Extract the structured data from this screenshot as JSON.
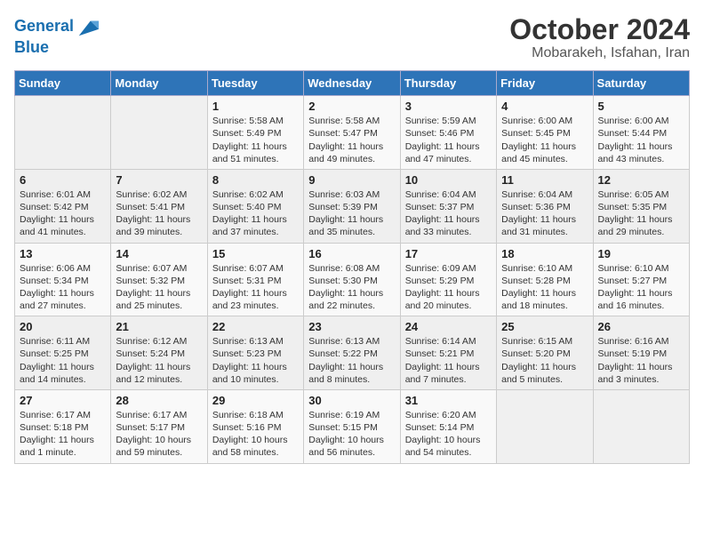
{
  "header": {
    "logo_line1": "General",
    "logo_line2": "Blue",
    "title": "October 2024",
    "subtitle": "Mobarakeh, Isfahan, Iran"
  },
  "weekdays": [
    "Sunday",
    "Monday",
    "Tuesday",
    "Wednesday",
    "Thursday",
    "Friday",
    "Saturday"
  ],
  "weeks": [
    [
      {
        "day": "",
        "info": ""
      },
      {
        "day": "",
        "info": ""
      },
      {
        "day": "1",
        "info": "Sunrise: 5:58 AM\nSunset: 5:49 PM\nDaylight: 11 hours and 51 minutes."
      },
      {
        "day": "2",
        "info": "Sunrise: 5:58 AM\nSunset: 5:47 PM\nDaylight: 11 hours and 49 minutes."
      },
      {
        "day": "3",
        "info": "Sunrise: 5:59 AM\nSunset: 5:46 PM\nDaylight: 11 hours and 47 minutes."
      },
      {
        "day": "4",
        "info": "Sunrise: 6:00 AM\nSunset: 5:45 PM\nDaylight: 11 hours and 45 minutes."
      },
      {
        "day": "5",
        "info": "Sunrise: 6:00 AM\nSunset: 5:44 PM\nDaylight: 11 hours and 43 minutes."
      }
    ],
    [
      {
        "day": "6",
        "info": "Sunrise: 6:01 AM\nSunset: 5:42 PM\nDaylight: 11 hours and 41 minutes."
      },
      {
        "day": "7",
        "info": "Sunrise: 6:02 AM\nSunset: 5:41 PM\nDaylight: 11 hours and 39 minutes."
      },
      {
        "day": "8",
        "info": "Sunrise: 6:02 AM\nSunset: 5:40 PM\nDaylight: 11 hours and 37 minutes."
      },
      {
        "day": "9",
        "info": "Sunrise: 6:03 AM\nSunset: 5:39 PM\nDaylight: 11 hours and 35 minutes."
      },
      {
        "day": "10",
        "info": "Sunrise: 6:04 AM\nSunset: 5:37 PM\nDaylight: 11 hours and 33 minutes."
      },
      {
        "day": "11",
        "info": "Sunrise: 6:04 AM\nSunset: 5:36 PM\nDaylight: 11 hours and 31 minutes."
      },
      {
        "day": "12",
        "info": "Sunrise: 6:05 AM\nSunset: 5:35 PM\nDaylight: 11 hours and 29 minutes."
      }
    ],
    [
      {
        "day": "13",
        "info": "Sunrise: 6:06 AM\nSunset: 5:34 PM\nDaylight: 11 hours and 27 minutes."
      },
      {
        "day": "14",
        "info": "Sunrise: 6:07 AM\nSunset: 5:32 PM\nDaylight: 11 hours and 25 minutes."
      },
      {
        "day": "15",
        "info": "Sunrise: 6:07 AM\nSunset: 5:31 PM\nDaylight: 11 hours and 23 minutes."
      },
      {
        "day": "16",
        "info": "Sunrise: 6:08 AM\nSunset: 5:30 PM\nDaylight: 11 hours and 22 minutes."
      },
      {
        "day": "17",
        "info": "Sunrise: 6:09 AM\nSunset: 5:29 PM\nDaylight: 11 hours and 20 minutes."
      },
      {
        "day": "18",
        "info": "Sunrise: 6:10 AM\nSunset: 5:28 PM\nDaylight: 11 hours and 18 minutes."
      },
      {
        "day": "19",
        "info": "Sunrise: 6:10 AM\nSunset: 5:27 PM\nDaylight: 11 hours and 16 minutes."
      }
    ],
    [
      {
        "day": "20",
        "info": "Sunrise: 6:11 AM\nSunset: 5:25 PM\nDaylight: 11 hours and 14 minutes."
      },
      {
        "day": "21",
        "info": "Sunrise: 6:12 AM\nSunset: 5:24 PM\nDaylight: 11 hours and 12 minutes."
      },
      {
        "day": "22",
        "info": "Sunrise: 6:13 AM\nSunset: 5:23 PM\nDaylight: 11 hours and 10 minutes."
      },
      {
        "day": "23",
        "info": "Sunrise: 6:13 AM\nSunset: 5:22 PM\nDaylight: 11 hours and 8 minutes."
      },
      {
        "day": "24",
        "info": "Sunrise: 6:14 AM\nSunset: 5:21 PM\nDaylight: 11 hours and 7 minutes."
      },
      {
        "day": "25",
        "info": "Sunrise: 6:15 AM\nSunset: 5:20 PM\nDaylight: 11 hours and 5 minutes."
      },
      {
        "day": "26",
        "info": "Sunrise: 6:16 AM\nSunset: 5:19 PM\nDaylight: 11 hours and 3 minutes."
      }
    ],
    [
      {
        "day": "27",
        "info": "Sunrise: 6:17 AM\nSunset: 5:18 PM\nDaylight: 11 hours and 1 minute."
      },
      {
        "day": "28",
        "info": "Sunrise: 6:17 AM\nSunset: 5:17 PM\nDaylight: 10 hours and 59 minutes."
      },
      {
        "day": "29",
        "info": "Sunrise: 6:18 AM\nSunset: 5:16 PM\nDaylight: 10 hours and 58 minutes."
      },
      {
        "day": "30",
        "info": "Sunrise: 6:19 AM\nSunset: 5:15 PM\nDaylight: 10 hours and 56 minutes."
      },
      {
        "day": "31",
        "info": "Sunrise: 6:20 AM\nSunset: 5:14 PM\nDaylight: 10 hours and 54 minutes."
      },
      {
        "day": "",
        "info": ""
      },
      {
        "day": "",
        "info": ""
      }
    ]
  ]
}
